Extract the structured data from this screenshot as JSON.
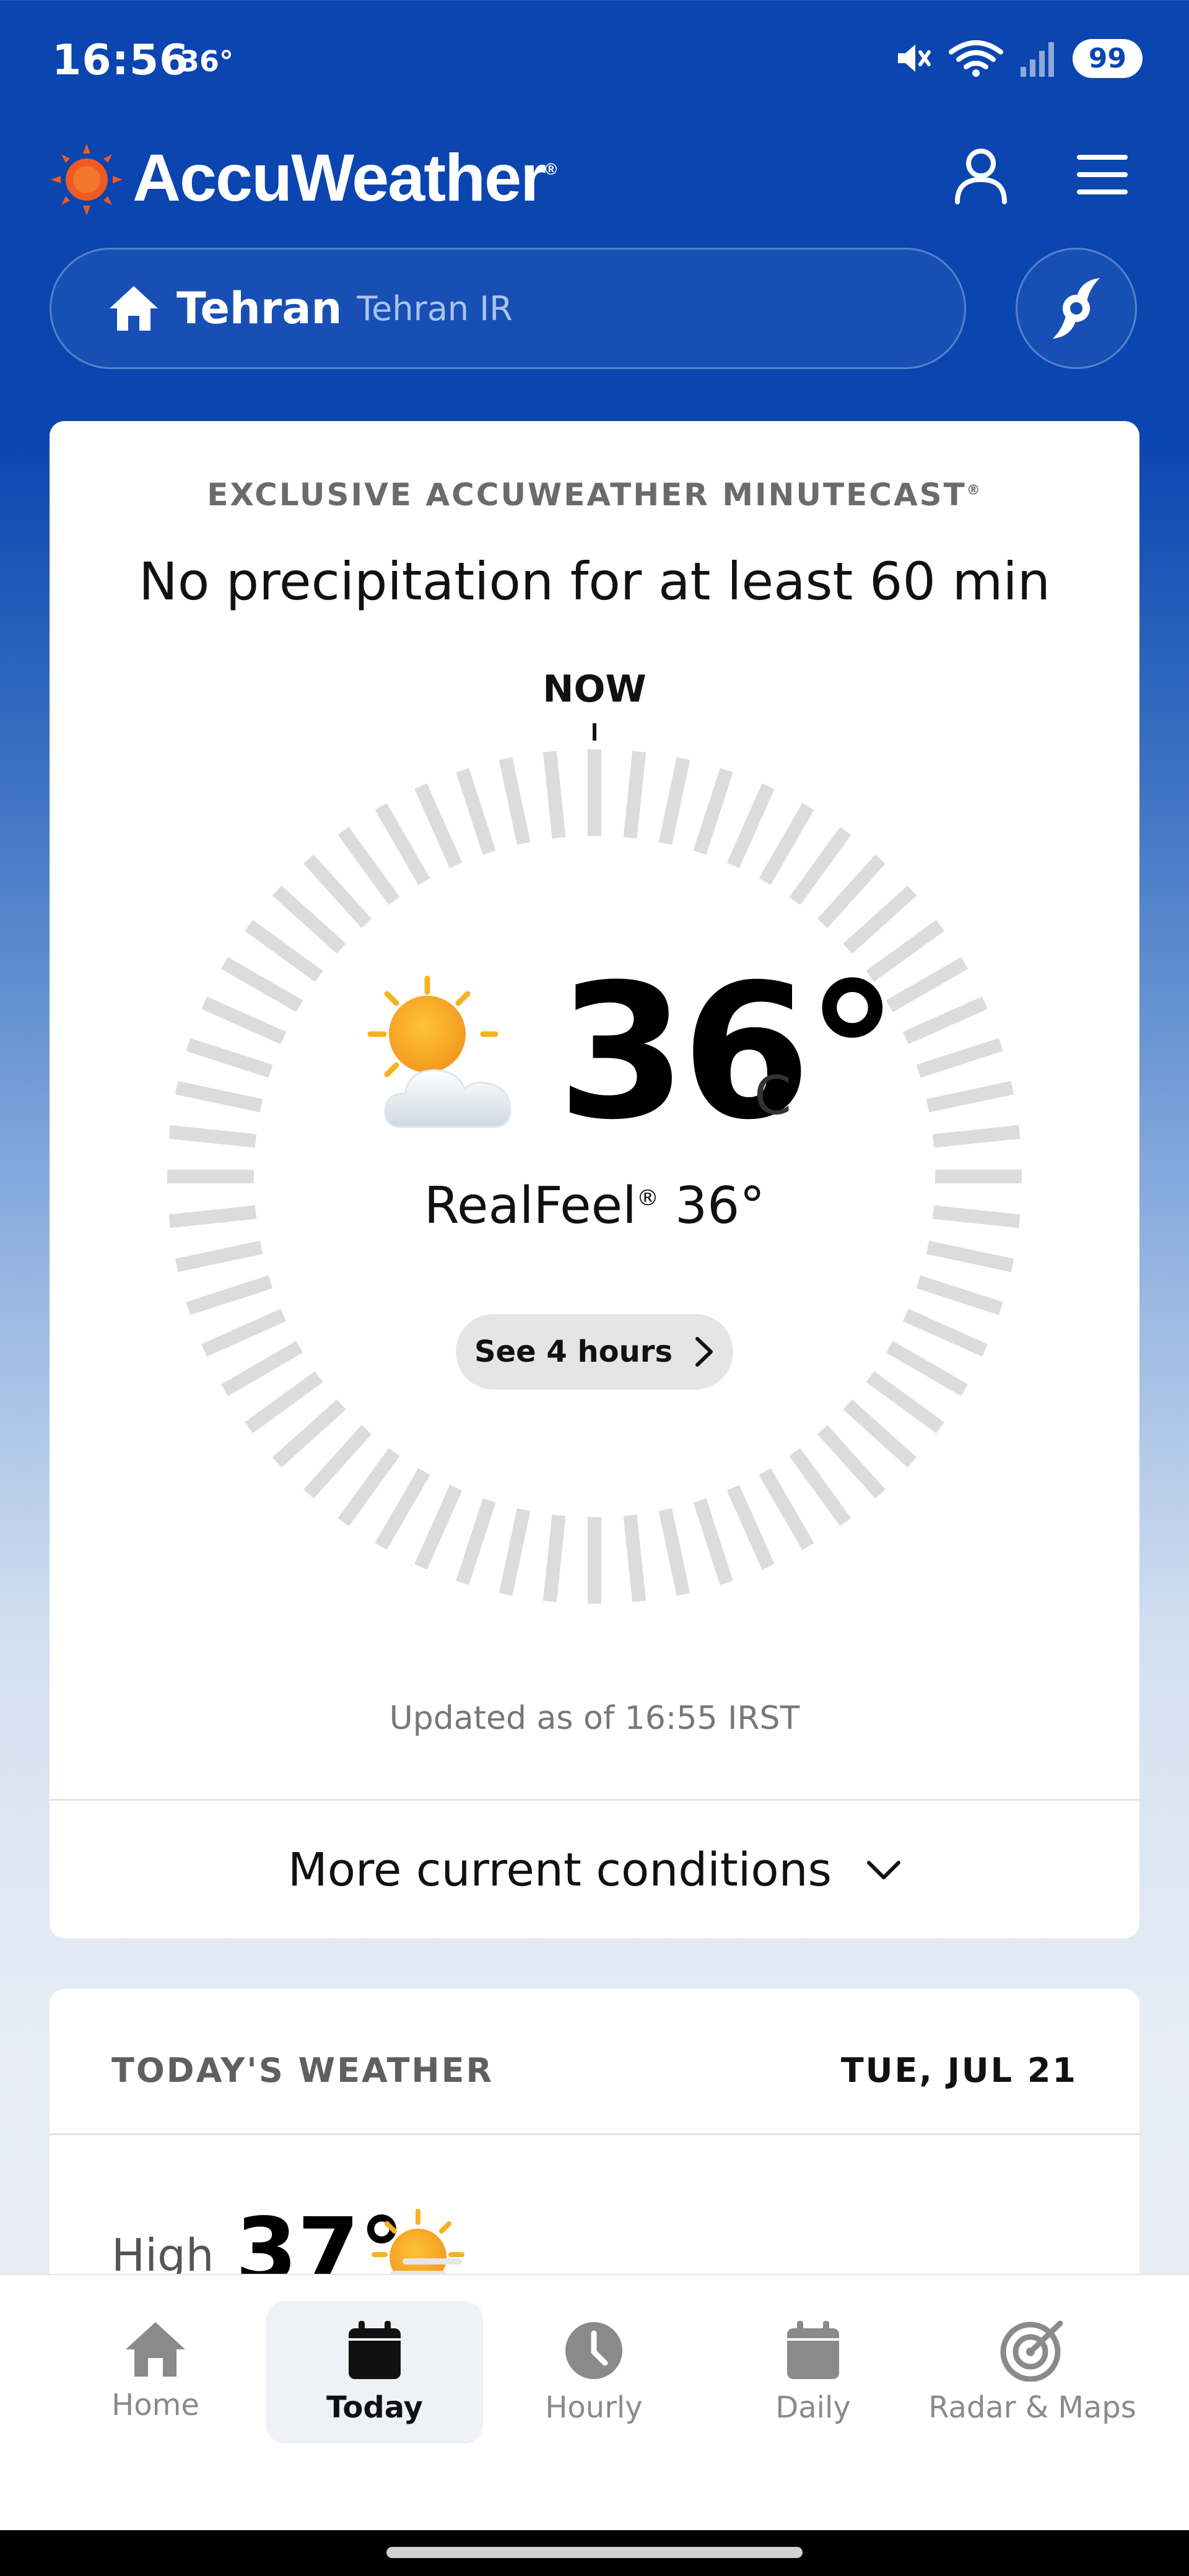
{
  "status_bar": {
    "time": "16:56",
    "temp": "36°",
    "battery": "99"
  },
  "header": {
    "brand": "AccuWeather",
    "brand_mark": "®",
    "icons": [
      "profile-icon",
      "menu-icon",
      "home-icon",
      "hurricane-icon"
    ]
  },
  "location": {
    "name": "Tehran",
    "region": "Tehran IR"
  },
  "minutecast": {
    "title": "EXCLUSIVE ACCUWEATHER MINUTECAST",
    "title_mark": "®",
    "summary": "No precipitation for at least 60 min",
    "now_label": "NOW",
    "temperature": "36°",
    "unit": "C",
    "realfeel_label": "RealFeel",
    "realfeel_mark": "®",
    "realfeel_value": "36°",
    "see_hours": "See 4 hours",
    "updated": "Updated as of 16:55 IRST",
    "condition_icon": "partly-sunny-icon"
  },
  "more_conditions": "More current conditions",
  "todays_weather": {
    "title": "TODAY'S WEATHER",
    "date": "TUE, JUL 21",
    "high_label": "High",
    "high_temp": "37°"
  },
  "bottom_nav": {
    "items": [
      {
        "label": "Home",
        "icon": "home-icon"
      },
      {
        "label": "Today",
        "icon": "calendar-icon"
      },
      {
        "label": "Hourly",
        "icon": "clock-icon"
      },
      {
        "label": "Daily",
        "icon": "calendar-icon"
      },
      {
        "label": "Radar & Maps",
        "icon": "radar-icon"
      }
    ],
    "active": "Today"
  },
  "colors": {
    "brand_blue": "#0a45b0",
    "logo_orange": "#f05a22",
    "dial_tick": "#dcdcdc"
  }
}
